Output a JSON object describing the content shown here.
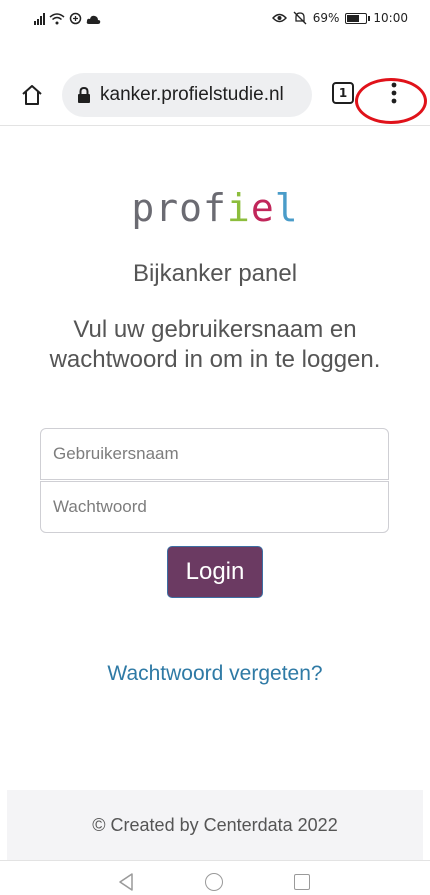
{
  "status_bar": {
    "battery_percent": "69%",
    "battery_level": 0.69,
    "time": "10:00",
    "icons": [
      "signal-icon",
      "wifi-icon",
      "data-saver-icon",
      "cloud-icon",
      "eye-comfort-icon",
      "mute-icon",
      "battery-icon"
    ]
  },
  "browser": {
    "url": "kanker.profielstudie.nl",
    "tab_count": "1",
    "icons": [
      "home-icon",
      "lock-icon",
      "tab-switcher-icon",
      "more-menu-icon"
    ],
    "highlight_color": "#e0121a"
  },
  "page": {
    "logo": {
      "parts": [
        "prof",
        "i",
        "e",
        "l"
      ],
      "colors": {
        "text": "#6b6b72",
        "i": "#8cbd3c",
        "e": "#c1265a",
        "l": "#4a9cc9"
      }
    },
    "panel_title": "Bijkanker panel",
    "instructions": "Vul uw gebruikersnaam en wachtwoord in om in te loggen.",
    "username_placeholder": "Gebruikersnaam",
    "password_placeholder": "Wachtwoord",
    "login_label": "Login",
    "forgot_label": "Wachtwoord vergeten?",
    "footer": "© Created by Centerdata 2022",
    "colors": {
      "button": "#6b3a62",
      "link": "#2f7aa5"
    }
  },
  "nav_bar": {
    "icons": [
      "back-icon",
      "home-circle-icon",
      "recent-apps-icon"
    ]
  }
}
